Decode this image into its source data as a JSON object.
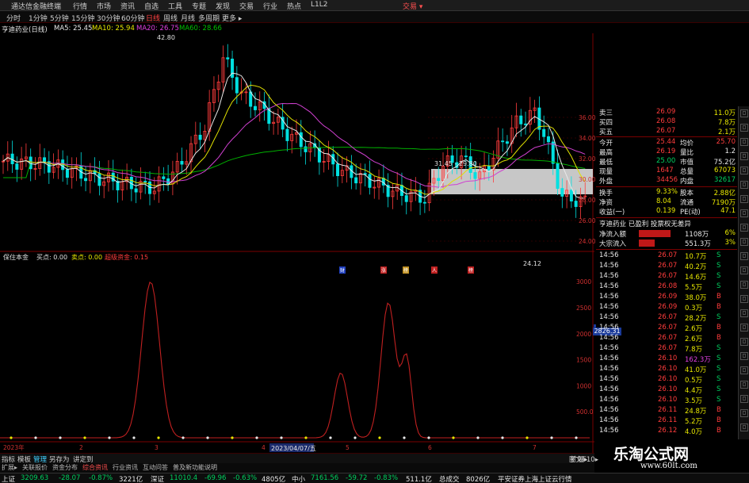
{
  "window": {
    "title": "通达信金融终端",
    "menu": [
      "行情",
      "市场",
      "资讯",
      "自选",
      "工具",
      "专题",
      "发现",
      "交易",
      "行业",
      "热点",
      "L1L2"
    ],
    "right_label": "交易 ▾"
  },
  "toolbar": {
    "items": [
      "分时",
      "1分钟",
      "5分钟",
      "15分钟",
      "30分钟",
      "60分钟",
      "日线",
      "周线",
      "月线",
      "多周期",
      "更多 ▸"
    ],
    "active_index": 6
  },
  "stock_header": {
    "name": "亨迪药业(日线)",
    "ma5": "MA5: 25.45",
    "ma10": "MA10: 25.94",
    "ma20": "MA20: 26.75",
    "ma60": "MA60: 28.66"
  },
  "price_chart": {
    "y_ticks": [
      "36.00",
      "34.00",
      "32.00",
      "30.00",
      "28.00",
      "26.00",
      "24.00"
    ],
    "annotations": {
      "high": "42.80",
      "low": "24.12",
      "range": "31.45 - 29.80"
    },
    "event_markers": [
      "财",
      "涨",
      "榜",
      "人",
      "榜"
    ]
  },
  "indicator": {
    "header": [
      "保住本金",
      "买点: 0.00",
      "卖点: 0.00",
      "超级资金: 0.15"
    ],
    "y_ticks": [
      "3000",
      "2500",
      "2000",
      "1500",
      "1000",
      "500.0"
    ],
    "highlight": "2826.31",
    "x_labels": [
      "2023年",
      "2",
      "3",
      "4",
      "5",
      "6",
      "7"
    ],
    "date_tag": "2023/04/07/五"
  },
  "quote": {
    "order_rows": [
      {
        "label": "卖三",
        "price": "26.09",
        "vol": "11.0万"
      },
      {
        "label": "买四",
        "price": "26.08",
        "vol": "7.8万"
      },
      {
        "label": "买五",
        "price": "26.07",
        "vol": "2.1万"
      }
    ],
    "stats": [
      {
        "l1": "今开",
        "v1": "25.44",
        "l2": "均价",
        "v2": "25.70"
      },
      {
        "l1": "最高",
        "v1": "26.19",
        "l2": "量比",
        "v2": "1.2"
      },
      {
        "l1": "最低",
        "v1": "25.00",
        "l2": "市值",
        "v2": "75.2亿"
      },
      {
        "l1": "现量",
        "v1": "1647",
        "l2": "总量",
        "v2": "67073"
      },
      {
        "l1": "外盘",
        "v1": "34456",
        "l2": "内盘",
        "v2": "32617"
      },
      {
        "l1": "换手",
        "v1": "9.33%",
        "l2": "股本",
        "v2": "2.88亿"
      },
      {
        "l1": "净资",
        "v1": "8.04",
        "l2": "流通",
        "v2": "7190万"
      },
      {
        "l1": "收益(一)",
        "v1": "0.139",
        "l2": "PE(动)",
        "v2": "47.1"
      }
    ],
    "info_bar": "亨迪药业 已盈利 投票权无差异",
    "flows": [
      {
        "label": "净流入额",
        "value": "1108万",
        "pct": "6%"
      },
      {
        "label": "大宗流入",
        "value": "551.3万",
        "pct": "3%"
      }
    ]
  },
  "trades": [
    {
      "time": "14:56",
      "price": "26.07",
      "vol": "10.7万",
      "side": "S"
    },
    {
      "time": "14:56",
      "price": "26.07",
      "vol": "40.2万",
      "side": "S"
    },
    {
      "time": "14:56",
      "price": "26.07",
      "vol": "14.6万",
      "side": "S"
    },
    {
      "time": "14:56",
      "price": "26.08",
      "vol": "5.5万",
      "side": "S"
    },
    {
      "time": "14:56",
      "price": "26.09",
      "vol": "38.0万",
      "side": "B"
    },
    {
      "time": "14:56",
      "price": "26.09",
      "vol": "0.3万",
      "side": "B"
    },
    {
      "time": "14:56",
      "price": "26.07",
      "vol": "28.2万",
      "side": "S"
    },
    {
      "time": "14:56",
      "price": "26.07",
      "vol": "2.6万",
      "side": "B"
    },
    {
      "time": "14:56",
      "price": "26.07",
      "vol": "2.6万",
      "side": "B"
    },
    {
      "time": "14:56",
      "price": "26.07",
      "vol": "7.8万",
      "side": "S"
    },
    {
      "time": "14:56",
      "price": "26.10",
      "vol": "162.3万",
      "side": "S"
    },
    {
      "time": "14:56",
      "price": "26.10",
      "vol": "41.0万",
      "side": "S"
    },
    {
      "time": "14:56",
      "price": "26.10",
      "vol": "0.5万",
      "side": "S"
    },
    {
      "time": "14:56",
      "price": "26.10",
      "vol": "4.4万",
      "side": "S"
    },
    {
      "time": "14:56",
      "price": "26.10",
      "vol": "3.5万",
      "side": "S"
    },
    {
      "time": "14:56",
      "price": "26.11",
      "vol": "24.8万",
      "side": "B"
    },
    {
      "time": "14:56",
      "price": "26.11",
      "vol": "5.2万",
      "side": "B"
    },
    {
      "time": "14:56",
      "price": "26.12",
      "vol": "4.0万",
      "side": "B"
    }
  ],
  "bottom_tabs": [
    "指标",
    "模板",
    "管理",
    "另存为",
    "讲定到",
    "扩展▸"
  ],
  "bottom_tabs2": [
    "扩展▸",
    "关联报价",
    "资金分布",
    "综合资讯",
    "行业资讯",
    "互动问答",
    "普及新功能说明"
  ],
  "status": {
    "items": [
      {
        "name": "上证",
        "value": "3209.63",
        "chg": "-28.07",
        "pct": "-0.87%",
        "amt": "3221亿"
      },
      {
        "name": "深证",
        "value": "11010.4",
        "chg": "-69.96",
        "pct": "-0.63%",
        "amt": "4805亿"
      },
      {
        "name": "中小",
        "value": "7161.56",
        "chg": "-59.72",
        "pct": "-0.83%",
        "amt": "511.1亿"
      }
    ],
    "total_label": "总成交",
    "total_value": "8026亿",
    "broker": "平安证券上海上证云行情",
    "tool_label": "图文F10▸"
  },
  "watermark": {
    "line1": "乐淘公式网",
    "line2": "www.60lt.com"
  },
  "colors": {
    "up": "#ff3c3c",
    "down": "#00e0e0",
    "ma5": "#e8e8e8",
    "ma10": "#e8e800",
    "ma20": "#e040e0",
    "ma60": "#00c000",
    "grid": "#7a0000"
  }
}
